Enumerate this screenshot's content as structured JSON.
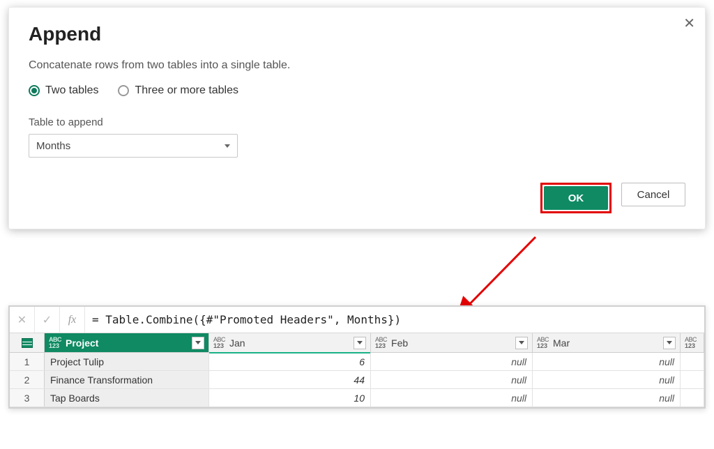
{
  "dialog": {
    "title": "Append",
    "description": "Concatenate rows from two tables into a single table.",
    "radios": {
      "two": "Two tables",
      "three": "Three or more tables"
    },
    "field_label": "Table to append",
    "select_value": "Months",
    "ok": "OK",
    "cancel": "Cancel"
  },
  "formula": "= Table.Combine({#\"Promoted Headers\", Months})",
  "type_icon": {
    "abc": "ABC",
    "num": "123"
  },
  "columns": {
    "project": "Project",
    "jan": "Jan",
    "feb": "Feb",
    "mar": "Mar"
  },
  "rows": [
    {
      "n": "1",
      "project": "Project Tulip",
      "jan": "6",
      "feb": "null",
      "mar": "null"
    },
    {
      "n": "2",
      "project": "Finance Transformation",
      "jan": "44",
      "feb": "null",
      "mar": "null"
    },
    {
      "n": "3",
      "project": "Tap Boards",
      "jan": "10",
      "feb": "null",
      "mar": "null"
    }
  ],
  "chart_data": {
    "type": "table",
    "columns": [
      "Project",
      "Jan",
      "Feb",
      "Mar"
    ],
    "rows": [
      [
        "Project Tulip",
        6,
        null,
        null
      ],
      [
        "Finance Transformation",
        44,
        null,
        null
      ],
      [
        "Tap Boards",
        10,
        null,
        null
      ]
    ]
  }
}
